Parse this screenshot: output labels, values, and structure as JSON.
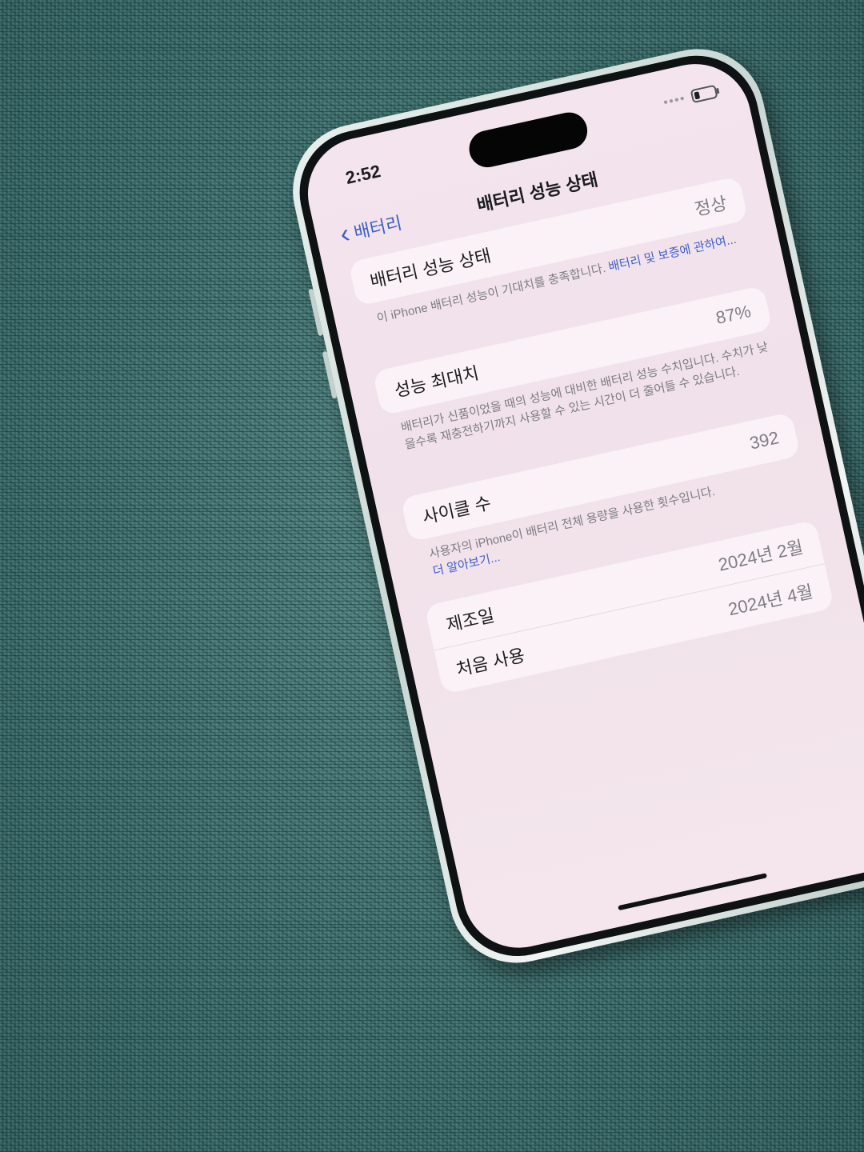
{
  "status_bar": {
    "time": "2:52"
  },
  "navigation": {
    "back_label": "배터리",
    "title": "배터리 성능 상태"
  },
  "battery_health_card": {
    "label": "배터리 성능 상태",
    "value": "정상"
  },
  "battery_health_note": {
    "text": "이 iPhone 배터리 성능이 기대치를 충족합니다.",
    "link": "배터리 및 보증에 관하여..."
  },
  "max_capacity_card": {
    "label": "성능 최대치",
    "value": "87%"
  },
  "max_capacity_note": {
    "text": "배터리가 신품이었을 때의 성능에 대비한 배터리 성능 수치입니다. 수치가 낮을수록 재충전하기까지 사용할 수 있는 시간이 더 줄어들 수 있습니다."
  },
  "cycle_count_card": {
    "label": "사이클 수",
    "value": "392"
  },
  "cycle_count_note": {
    "text": "사용자의 iPhone이 배터리 전체 용량을 사용한 횟수입니다.",
    "link": "더 알아보기..."
  },
  "dates_card": {
    "rows": [
      {
        "label": "제조일",
        "value": "2024년 2월"
      },
      {
        "label": "처음 사용",
        "value": "2024년 4월"
      }
    ]
  }
}
